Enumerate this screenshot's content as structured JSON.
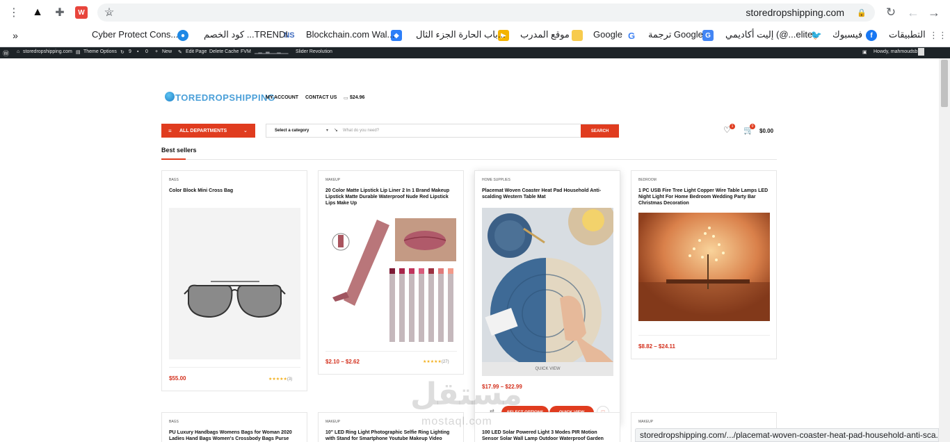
{
  "browser": {
    "url": "storedropshipping.com",
    "bookmarks": [
      {
        "label": "التطبيقات",
        "icon": "apps-grid-icon"
      },
      {
        "label": "فيسبوك",
        "icon": "facebook-icon"
      },
      {
        "label": "إليت أكاديمي (@...elite",
        "icon": "twitter-icon"
      },
      {
        "label": "ترجمة Google",
        "icon": "google-translate-icon"
      },
      {
        "label": "Google",
        "icon": "google-icon"
      },
      {
        "label": "موقع المدرب",
        "icon": "folder-icon"
      },
      {
        "label": "باب الحارة الجزء الثال...",
        "icon": "video-icon"
      },
      {
        "label": "Blockchain.com Wal...",
        "icon": "blockchain-icon"
      },
      {
        "label": "كود الخصم ...TRENDI",
        "icon": "ns-icon"
      },
      {
        "label": "Cyber Protect Cons...",
        "icon": "cyber-protect-icon"
      }
    ],
    "status_url": "storedropshipping.com/.../placemat-woven-coaster-heat-pad-household-anti-sca..."
  },
  "admin_bar": {
    "site": "storedropshipping.com",
    "theme_options": "Theme Options",
    "updates": "9",
    "comments": "0",
    "new": "New",
    "edit_page": "Edit Page",
    "delete_cache": "Delete Cache",
    "fvm": "FVM",
    "slider": "Slider Revolution",
    "howdy": "Howdy, mahmoudsb"
  },
  "header": {
    "logo_text": "TOREDROPSHIPPING",
    "nav": [
      "MY ACCOUNT",
      "CONTACT US"
    ],
    "cart_total_top": "$24.96",
    "departments_label": "ALL DEPARTMENTS",
    "category_select": "Select a category",
    "search_placeholder": "What do you need?",
    "search_button": "SEARCH",
    "wishlist_count": "1",
    "cart_count": "0",
    "cart_total": "$0.00"
  },
  "section": {
    "title": "Best sellers"
  },
  "products": [
    {
      "category": "BAGS",
      "name": "Color Block Mini Cross Bag",
      "price": "$55.00",
      "stars": "★★★★★",
      "reviews": "(3)"
    },
    {
      "category": "MAKEUP",
      "name": "20 Color Matte Lipstick Lip Liner 2 In 1 Brand Makeup Lipstick Matte Durable Waterproof Nude Red Lipstick Lips Make Up",
      "price": "$2.10 – $2.62",
      "stars": "★★★★★",
      "reviews": "(27)"
    },
    {
      "category": "HOME SUPPLIES",
      "name": "Placemat Woven Coaster Heat Pad Household Anti-scalding Western Table Mat",
      "price": "$17.99 – $22.99",
      "quick_view": "QUICK VIEW",
      "select_options": "SELECT OPTIONS",
      "quick_view_btn": "QUICK VIEW"
    },
    {
      "category": "BEDROOM",
      "name": "1 PC USB Fire Tree Light Copper Wire Table Lamps LED Night Light For Home Bedroom Wedding Party Bar Christmas Decoration",
      "price": "$8.82 – $24.11"
    }
  ],
  "products_row2": [
    {
      "category": "BAGS",
      "name": "PU Luxury Handbags Womens Bags for Woman 2020 Ladies Hand Bags Women's Crossbody Bags Purse"
    },
    {
      "category": "MAKEUP",
      "name": "10\" LED Ring Light Photographic Selfie Ring Lighting with Stand for Smartphone Youtube Makeup Video"
    },
    {
      "category": "",
      "name": "100 LED Solar Powered Light 3 Modes PIR Motion Sensor Solar Wall Lamp Outdoor Waterproof Garden"
    },
    {
      "category": "MAKEUP",
      "name": ""
    }
  ],
  "watermark": {
    "arabic": "مستقل",
    "latin": "mostaql.com"
  },
  "colors": {
    "accent": "#e03c1f",
    "price": "#d32f1c",
    "star": "#f2b01e",
    "adminbar": "#1d2327"
  }
}
